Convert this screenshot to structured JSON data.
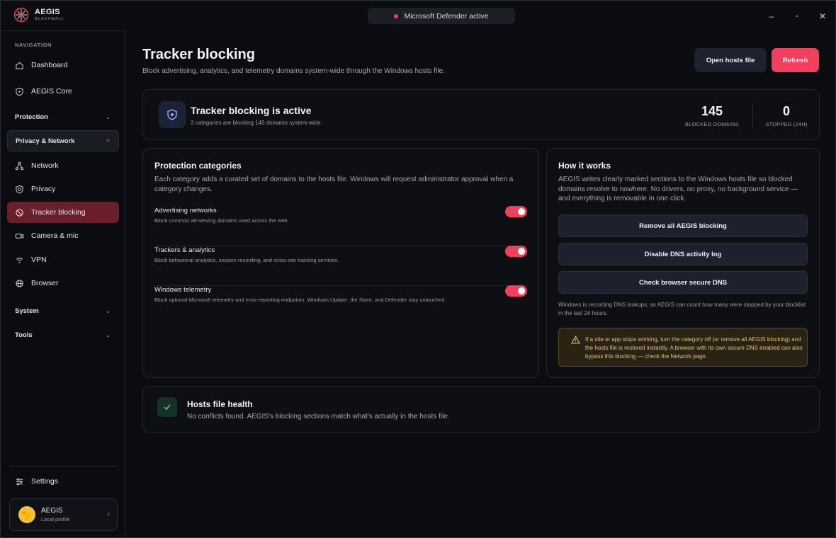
{
  "app": {
    "name": "AEGIS",
    "subtitle": "BLACKWALL"
  },
  "status_pill": {
    "text": "Microsoft Defender active",
    "dot_color": "#f0405e"
  },
  "window_controls": {
    "minimize": "–",
    "maximize": "▫",
    "close": "✕"
  },
  "sidebar": {
    "heading": "NAVIGATION",
    "items_top": [
      {
        "label": "Dashboard",
        "icon": "home-icon"
      },
      {
        "label": "AEGIS Core",
        "icon": "shield-icon"
      }
    ],
    "groups": {
      "protection": "Protection",
      "privacy_network": "Privacy & Network",
      "system": "System",
      "tools": "Tools"
    },
    "privacy_items": [
      {
        "label": "Network",
        "icon": "network-icon"
      },
      {
        "label": "Privacy",
        "icon": "shield-check-icon"
      },
      {
        "label": "Tracker blocking",
        "icon": "block-icon",
        "active": true
      },
      {
        "label": "Camera & mic",
        "icon": "camera-icon"
      },
      {
        "label": "VPN",
        "icon": "vpn-icon"
      },
      {
        "label": "Browser",
        "icon": "globe-icon"
      }
    ],
    "settings": "Settings",
    "profile": {
      "name": "AEGIS",
      "sub": "Local profile"
    }
  },
  "header": {
    "title": "Tracker blocking",
    "subtitle": "Block advertising, analytics, and telemetry domains system-wide through the Windows hosts file.",
    "open_hosts": "Open hosts file",
    "refresh": "Refresh"
  },
  "hero": {
    "title": "Tracker blocking is active",
    "sub": "3 categories are blocking 145 domains system-wide.",
    "stats": [
      {
        "value": "145",
        "label": "BLOCKED DOMAINS"
      },
      {
        "value": "0",
        "label": "STOPPED (24H)"
      }
    ]
  },
  "categories": {
    "title": "Protection categories",
    "desc": "Each category adds a curated set of domains to the hosts file. Windows will request administrator approval when a category changes.",
    "items": [
      {
        "name": "Advertising networks",
        "desc": "Block common ad-serving domains used across the web.",
        "enabled": true
      },
      {
        "name": "Trackers & analytics",
        "desc": "Block behavioral analytics, session recording, and cross-site tracking services.",
        "enabled": true
      },
      {
        "name": "Windows telemetry",
        "desc": "Block optional Microsoft telemetry and error-reporting endpoints. Windows Update, the Store, and Defender stay untouched.",
        "enabled": true
      }
    ]
  },
  "how": {
    "title": "How it works",
    "desc": "AEGIS writes clearly marked sections to the Windows hosts file so blocked domains resolve to nowhere. No drivers, no proxy, no background service — and everything is removable in one click.",
    "buttons": [
      "Remove all AEGIS blocking",
      "Disable DNS activity log",
      "Check browser secure DNS"
    ],
    "note": "Windows is recording DNS lookups, so AEGIS can count how many were stopped by your blocklist in the last 24 hours.",
    "warning": "If a site or app stops working, turn the category off (or remove all AEGIS blocking) and the hosts file is restored instantly. A browser with its own secure DNS enabled can also bypass this blocking — check the Network page."
  },
  "health": {
    "title": "Hosts file health",
    "sub": "No conflicts found. AEGIS's blocking sections match what's actually in the hosts file."
  }
}
